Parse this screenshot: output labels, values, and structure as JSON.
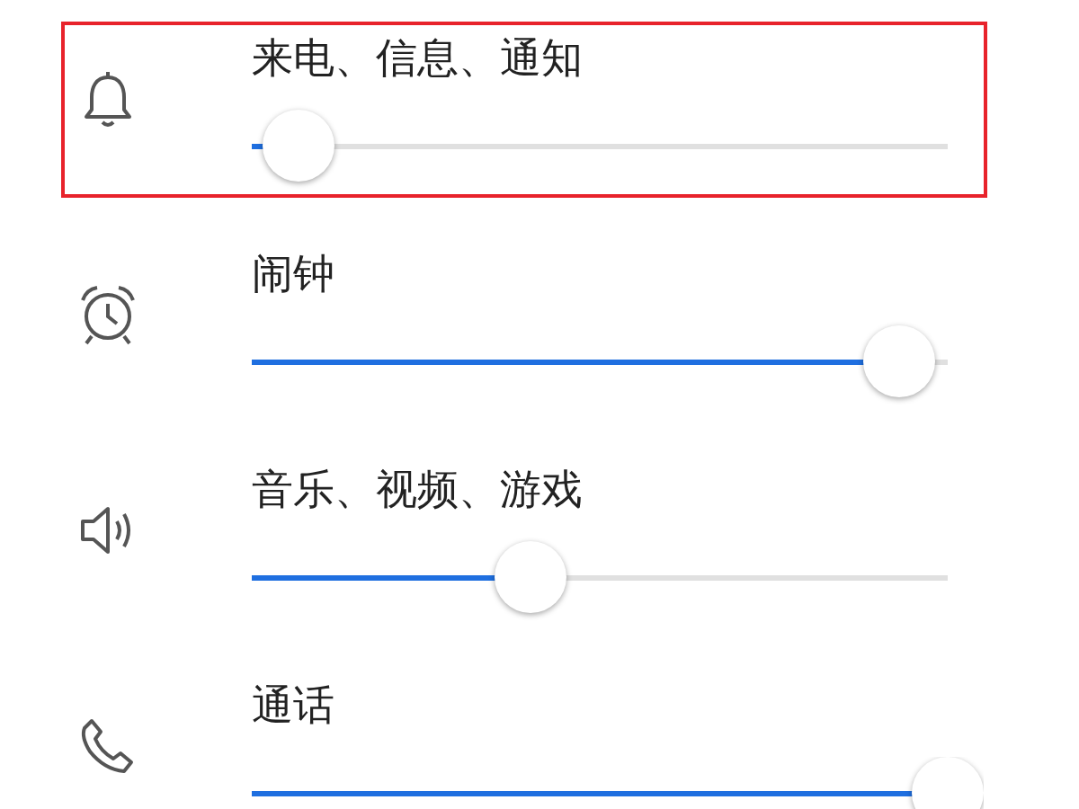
{
  "volume_rows": [
    {
      "kind": "bell",
      "label": "来电、信息、通知",
      "level": 0.067,
      "highlighted": true
    },
    {
      "kind": "alarm",
      "label": "闹钟",
      "level": 0.93,
      "highlighted": false
    },
    {
      "kind": "speaker",
      "label": "音乐、视频、游戏",
      "level": 0.4,
      "highlighted": false
    },
    {
      "kind": "phone",
      "label": "通话",
      "level": 1.0,
      "highlighted": false
    }
  ]
}
